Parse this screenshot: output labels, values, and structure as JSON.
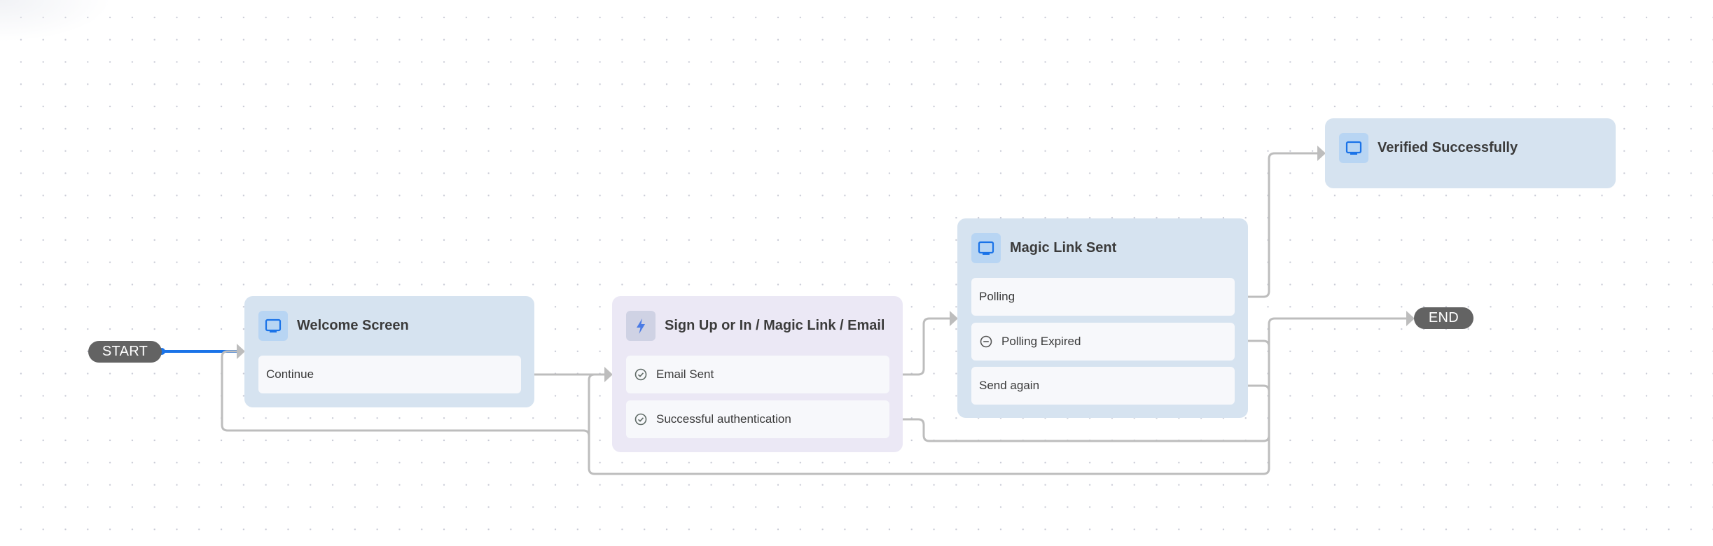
{
  "canvas": {
    "background": "#ffffff",
    "grid_dot_color": "#c9cbd6"
  },
  "colors": {
    "screen_node_bg": "#d6e3f0",
    "action_node_bg": "#ebe8f5",
    "row_bg": "#f7f8fb",
    "terminal_bg": "#636363",
    "edge": "#bdbdbd",
    "edge_active": "#1a73e8",
    "screen_icon": "#1a73e8",
    "action_icon": "#4b7be5"
  },
  "terminals": {
    "start": {
      "label": "START"
    },
    "end": {
      "label": "END"
    }
  },
  "nodes": {
    "welcome": {
      "type": "screen",
      "icon": "monitor-icon",
      "title": "Welcome Screen",
      "outputs": [
        {
          "label": "Continue",
          "icon": null
        }
      ]
    },
    "signup": {
      "type": "action",
      "icon": "lightning-icon",
      "title": "Sign Up or In / Magic Link / Email",
      "outputs": [
        {
          "label": "Email Sent",
          "icon": "check-circle-icon"
        },
        {
          "label": "Successful authentication",
          "icon": "check-circle-icon"
        }
      ]
    },
    "magic": {
      "type": "screen",
      "icon": "monitor-icon",
      "title": "Magic Link Sent",
      "outputs": [
        {
          "label": "Polling",
          "icon": null
        },
        {
          "label": "Polling Expired",
          "icon": "minus-circle-icon"
        },
        {
          "label": "Send again",
          "icon": null
        }
      ]
    },
    "verified": {
      "type": "screen",
      "icon": "monitor-icon",
      "title": "Verified Successfully",
      "outputs": []
    }
  },
  "edges": [
    {
      "from": "START",
      "to": "Welcome Screen",
      "active": true
    },
    {
      "from": "Welcome Screen / Continue",
      "to": "Sign Up or In / Magic Link / Email"
    },
    {
      "from": "Sign Up or In / Magic Link / Email / Email Sent",
      "to": "Magic Link Sent"
    },
    {
      "from": "Sign Up or In / Magic Link / Email / Successful authentication",
      "to": "END"
    },
    {
      "from": "Magic Link Sent / Polling",
      "to": "Verified Successfully"
    },
    {
      "from": "Magic Link Sent / Polling Expired",
      "to": "END"
    },
    {
      "from": "Magic Link Sent / Send again",
      "to": "Sign Up or In / Magic Link / Email"
    },
    {
      "from": "Magic Link Sent / Send again",
      "to": "Welcome Screen"
    }
  ]
}
